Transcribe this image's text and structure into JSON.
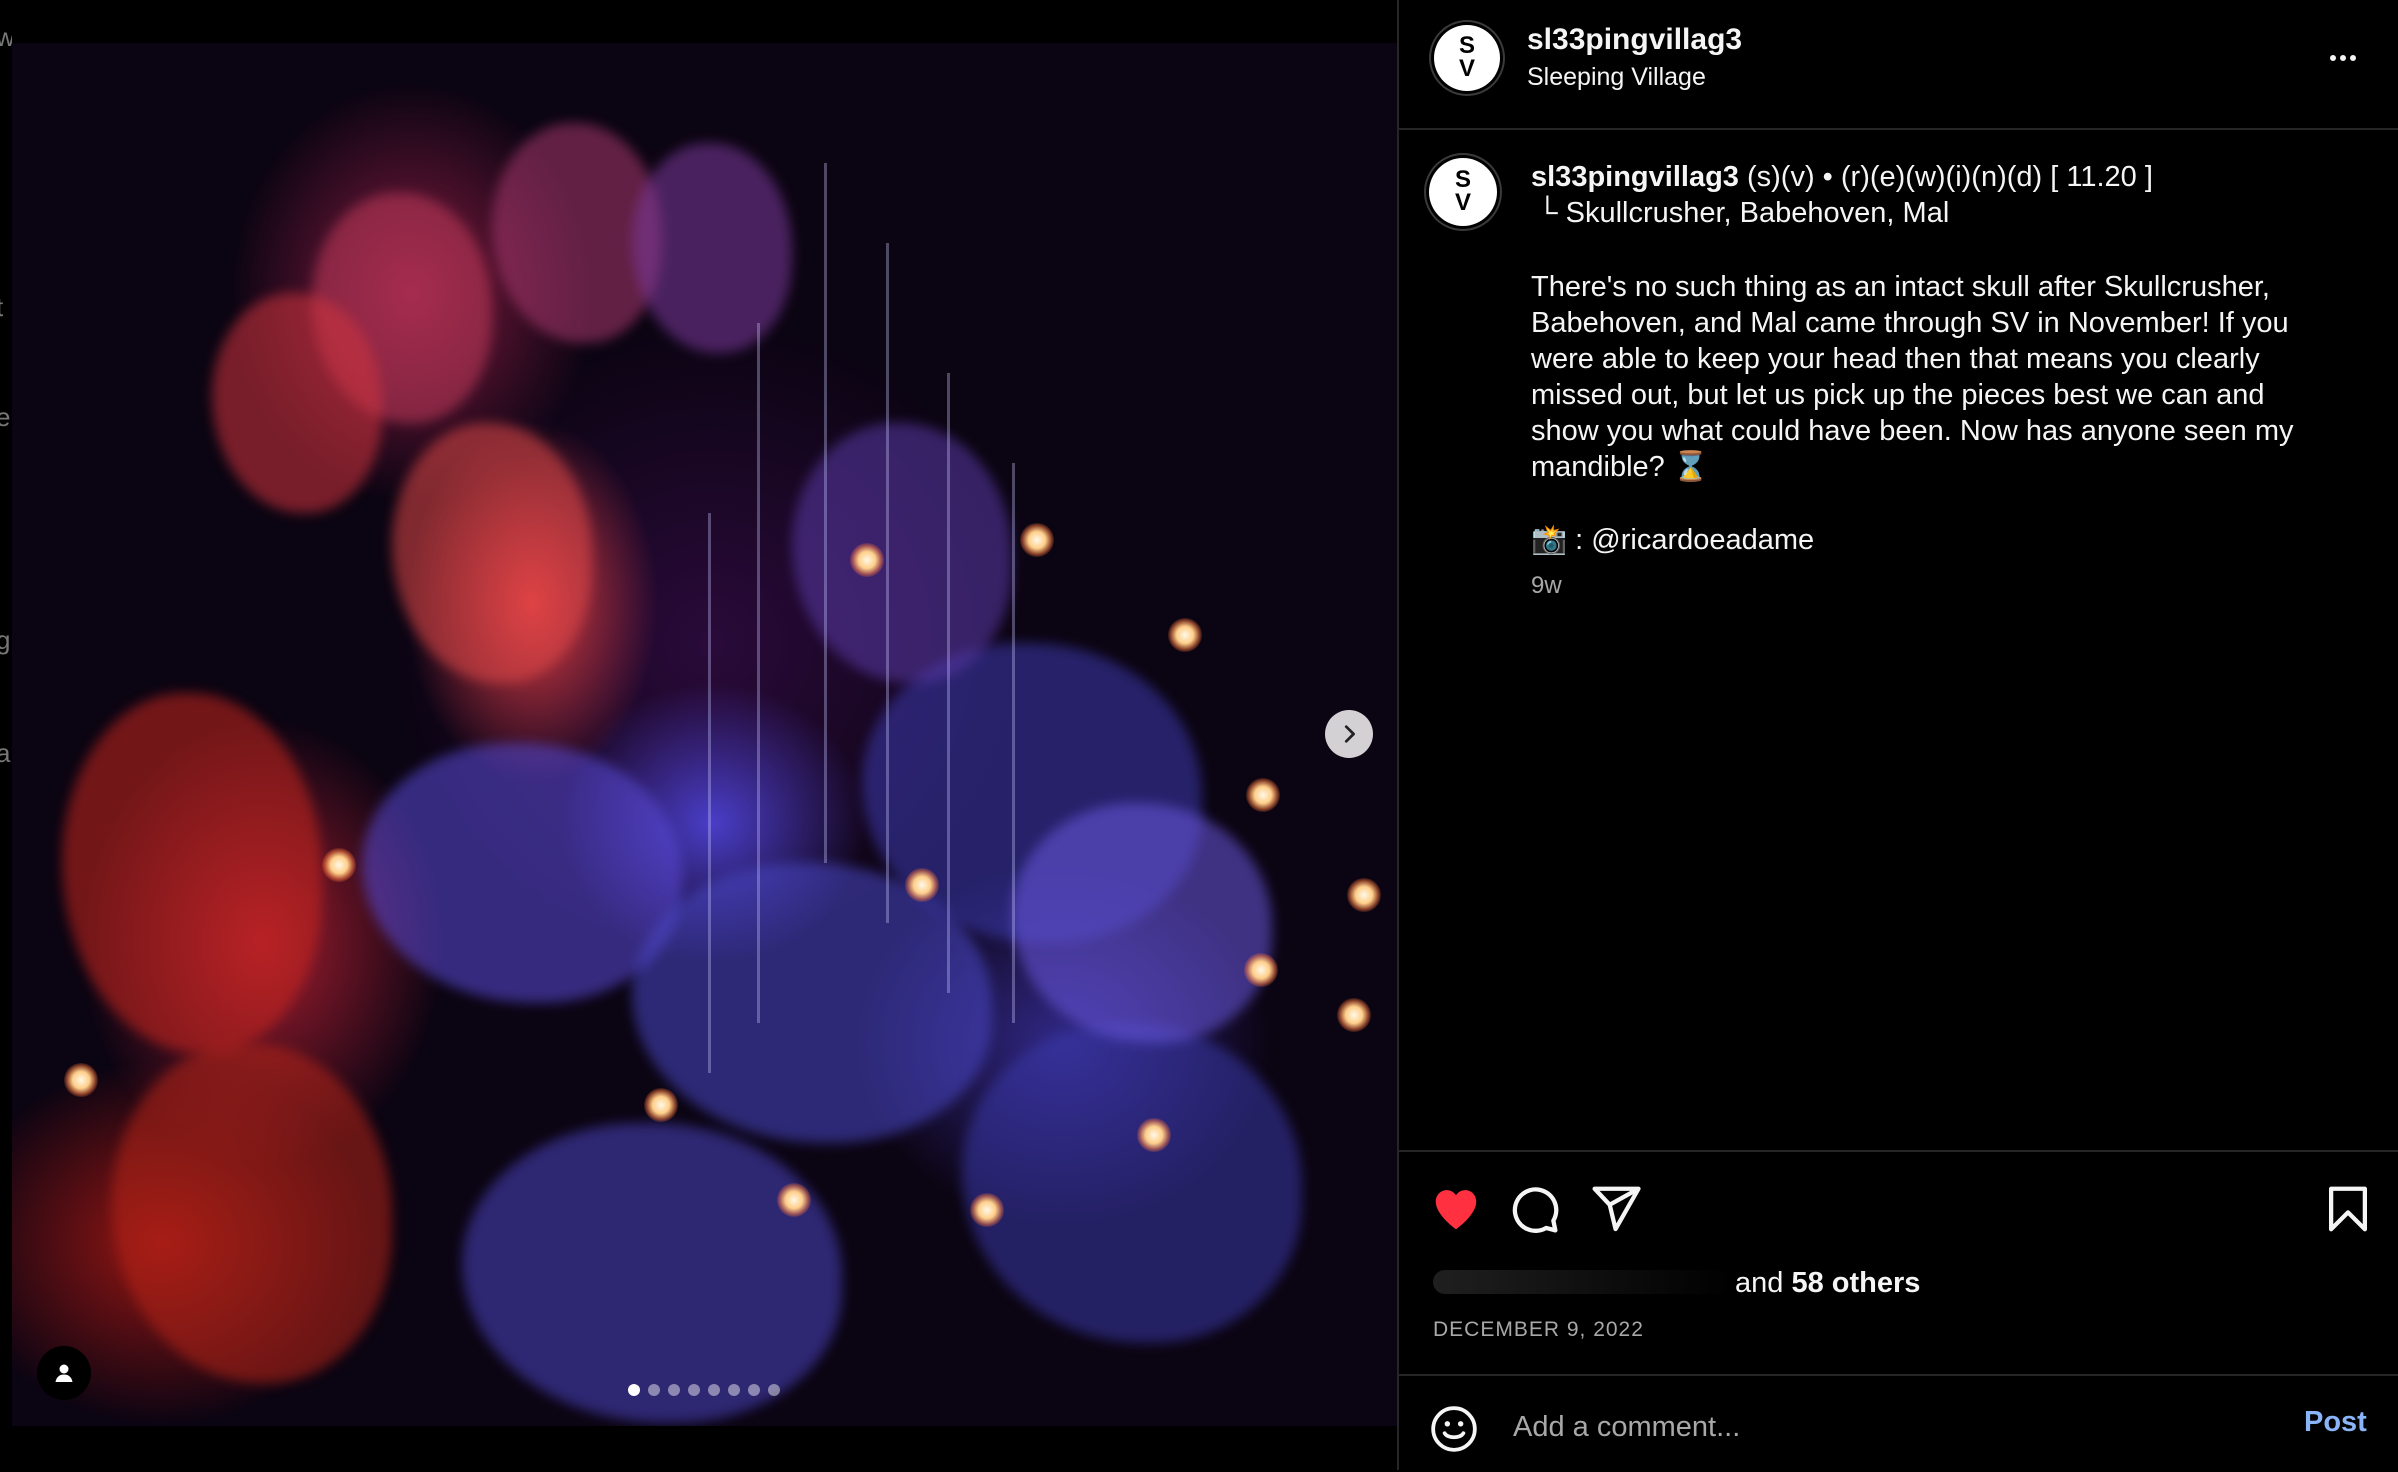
{
  "header": {
    "username": "sl33pingvillag3",
    "subtitle": "Sleeping Village",
    "avatar_initials_top": "S",
    "avatar_initials_bottom": "V"
  },
  "caption": {
    "username": "sl33pingvillag3",
    "title_rest": " (s)(v) • (r)(e)(w)(i)(n)(d) [ 11.20 ]",
    "subheading": "└ Skullcrusher, Babehoven, Mal",
    "body": "There's no such thing as an intact skull after Skullcrusher, Babehoven, and Mal came through SV in November! If you were able to keep your head then that means you clearly missed out, but let us pick up the pieces best we can and show you what could have been. Now has anyone seen my mandible? ⌛",
    "credit": "📸 : @ricardoeadame",
    "time": "9w"
  },
  "likes": {
    "prefix": "and ",
    "count": "58 others"
  },
  "post_date": "DECEMBER 9, 2022",
  "comment": {
    "placeholder": "Add a comment...",
    "post_label": "Post"
  },
  "carousel": {
    "total_slides": 8,
    "active_index": 0
  },
  "left_edge_fragments": [
    "w",
    "t",
    "e",
    "g",
    "a"
  ],
  "colors": {
    "like_red": "#ff3040",
    "post_blue": "#8ab4f8",
    "border": "#262626"
  }
}
